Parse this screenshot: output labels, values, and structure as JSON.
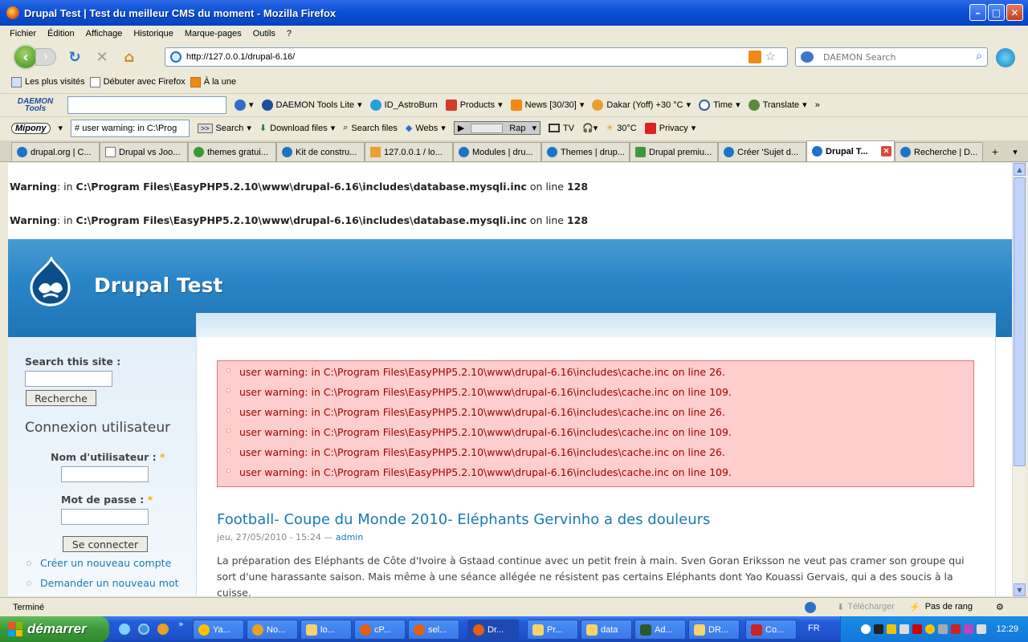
{
  "window": {
    "title": "Drupal Test | Test du meilleur CMS du moment - Mozilla Firefox"
  },
  "menu": [
    "Fichier",
    "Édition",
    "Affichage",
    "Historique",
    "Marque-pages",
    "Outils",
    "?"
  ],
  "nav": {
    "url": "http://127.0.0.1/drupal-6.16/",
    "search_placeholder": "DAEMON Search"
  },
  "bookmarks": [
    "Les plus visités",
    "Débuter avec Firefox",
    "À la une"
  ],
  "toolbar1": {
    "daemon_logo": "DAEMON Tools",
    "items": [
      "DAEMON Tools Lite",
      "ID_AstroBurn",
      "Products",
      "News [30/30]",
      "Dakar (Yoff) +30 °C",
      "Time",
      "Translate"
    ]
  },
  "toolbar2": {
    "mipony": "Mipony",
    "combo_value": "# user warning: in C:\\Prog",
    "search": "Search",
    "items": [
      "Download files",
      "Search files",
      "Webs"
    ],
    "radio": "Rap",
    "tv": "TV",
    "temp": "30°C",
    "privacy": "Privacy"
  },
  "tabs": [
    "drupal.org | C...",
    "Drupal vs Joo...",
    "themes gratui...",
    "Kit de constru...",
    "127.0.0.1 / lo...",
    "Modules | dru...",
    "Themes | drup...",
    "Drupal premiu...",
    "Créer 'Sujet d...",
    "Drupal T...",
    "Recherche | D..."
  ],
  "warnings": [
    {
      "label": "Warning",
      "sep": ": in ",
      "path": "C:\\Program Files\\EasyPHP5.2.10\\www\\drupal-6.16\\includes\\database.mysqli.inc",
      "online": " on line ",
      "line": "128"
    },
    {
      "label": "Warning",
      "sep": ": in ",
      "path": "C:\\Program Files\\EasyPHP5.2.10\\www\\drupal-6.16\\includes\\database.mysqli.inc",
      "online": " on line ",
      "line": "128"
    }
  ],
  "site": {
    "name": "Drupal Test"
  },
  "sidebar": {
    "search_label": "Search this site :",
    "search_button": "Recherche",
    "login_title": "Connexion utilisateur",
    "username_label": "Nom d'utilisateur :",
    "password_label": "Mot de passe :",
    "required_mark": "*",
    "login_button": "Se connecter",
    "links": [
      "Créer un nouveau compte",
      "Demander un nouveau mot"
    ]
  },
  "errors": [
    "user warning: in C:\\Program Files\\EasyPHP5.2.10\\www\\drupal-6.16\\includes\\cache.inc on line 26.",
    "user warning: in C:\\Program Files\\EasyPHP5.2.10\\www\\drupal-6.16\\includes\\cache.inc on line 109.",
    "user warning: in C:\\Program Files\\EasyPHP5.2.10\\www\\drupal-6.16\\includes\\cache.inc on line 26.",
    "user warning: in C:\\Program Files\\EasyPHP5.2.10\\www\\drupal-6.16\\includes\\cache.inc on line 109.",
    "user warning: in C:\\Program Files\\EasyPHP5.2.10\\www\\drupal-6.16\\includes\\cache.inc on line 26.",
    "user warning: in C:\\Program Files\\EasyPHP5.2.10\\www\\drupal-6.16\\includes\\cache.inc on line 109."
  ],
  "node": {
    "title": "Football- Coupe du Monde 2010- Eléphants Gervinho a des douleurs",
    "date": "jeu, 27/05/2010 - 15:24 — ",
    "author": "admin",
    "body": "La préparation des Eléphants de Côte d'Ivoire à Gstaad continue avec un petit frein à main. Sven Goran Eriksson ne veut pas cramer son groupe qui sort d'une harassante saison. Mais même à une séance allégée ne résistent pas certains Eléphants dont Yao Kouassi Gervais, qui a des soucis à la cuisse."
  },
  "status": {
    "text": "Terminé",
    "download": "Télécharger",
    "rank": "Pas de rang"
  },
  "taskbar": {
    "start": "démarrer",
    "tasks": [
      "Ya...",
      "No...",
      "lo...",
      "cP...",
      "sel...",
      "Dr...",
      "Pr...",
      "data",
      "Ad...",
      "DR...",
      "Co..."
    ],
    "lang": "FR",
    "clock": "12:29"
  },
  "colors": {
    "link": "#1b78b6",
    "error_bg": "#fecdcd",
    "error_text": "#a30000",
    "header_blue": "#2a86c8"
  }
}
